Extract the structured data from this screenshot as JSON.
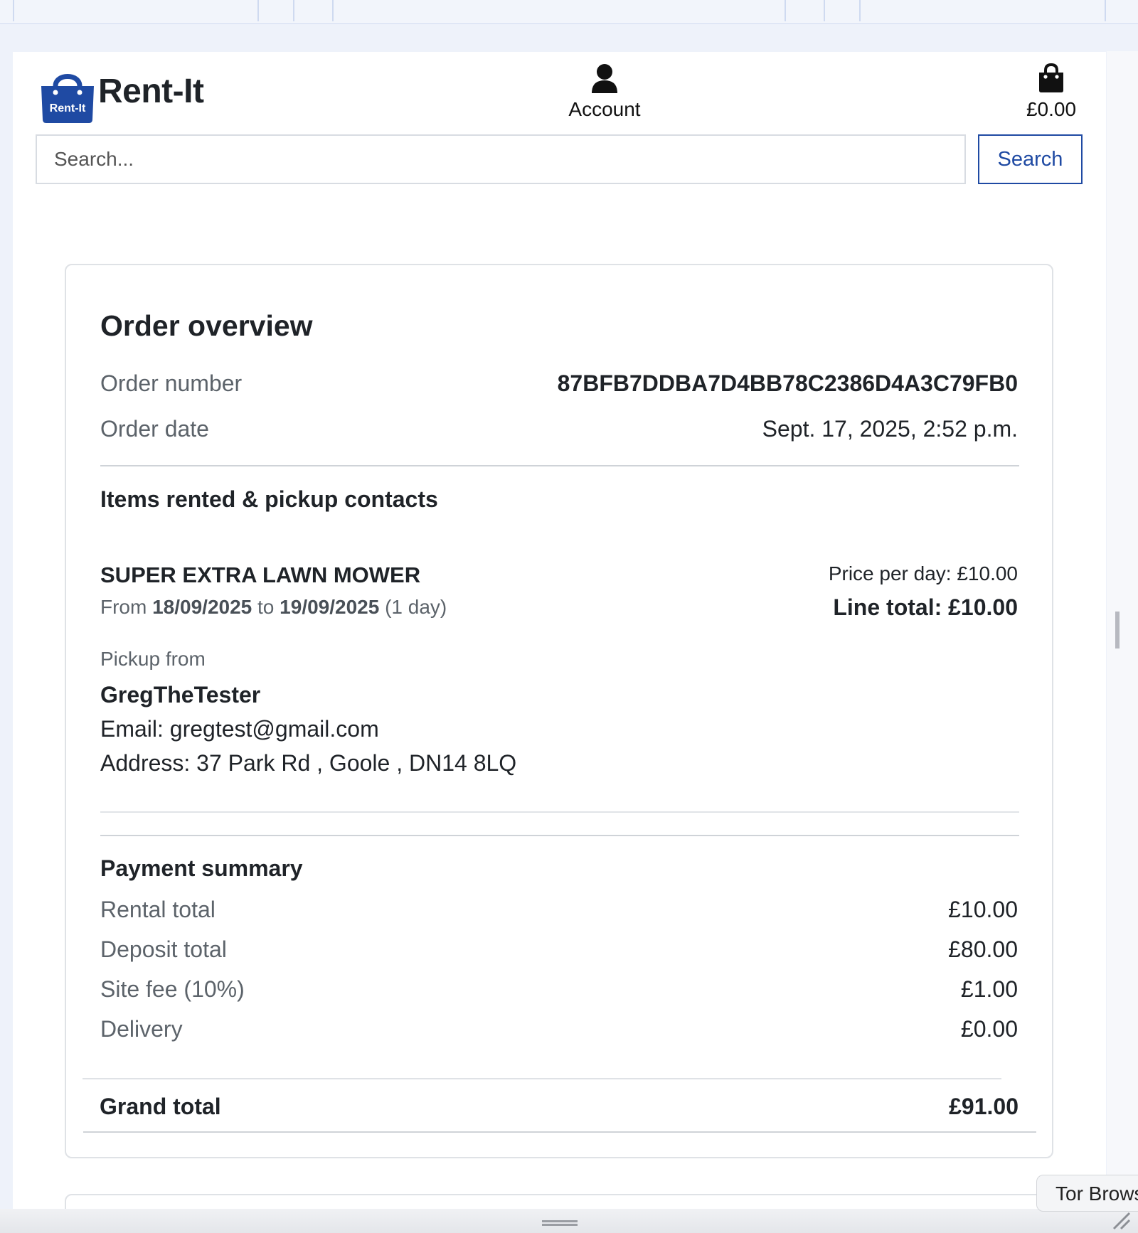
{
  "header": {
    "brand": "Rent-It",
    "logo_text": "Rent-It",
    "account_label": "Account",
    "basket_total": "£0.00"
  },
  "search": {
    "placeholder": "Search...",
    "button_label": "Search"
  },
  "order": {
    "title": "Order overview",
    "number_label": "Order number",
    "number_value": "87BFB7DDBA7D4BB78C2386D4A3C79FB0",
    "date_label": "Order date",
    "date_value": "Sept. 17, 2025, 2:52 p.m."
  },
  "items_section": {
    "title": "Items rented & pickup contacts",
    "items": [
      {
        "name": "SUPER EXTRA LAWN MOWER",
        "from_word": "From",
        "from_date": "18/09/2025",
        "to_word": "to",
        "to_date": "19/09/2025",
        "duration": "(1 day)",
        "price_per_day": "Price per day: £10.00",
        "line_total": "Line total: £10.00",
        "pickup_label": "Pickup from",
        "owner_name": "GregTheTester",
        "email": "Email: gregtest@gmail.com",
        "address": "Address: 37 Park Rd , Goole , DN14 8LQ"
      }
    ]
  },
  "payment": {
    "title": "Payment summary",
    "rows": [
      {
        "label": "Rental total",
        "value": "£10.00"
      },
      {
        "label": "Deposit total",
        "value": "£80.00"
      },
      {
        "label": "Site fee (10%)",
        "value": "£1.00"
      },
      {
        "label": "Delivery",
        "value": "£0.00"
      }
    ],
    "grand_label": "Grand total",
    "grand_value": "£91.00"
  },
  "browser": {
    "tooltip": "Tor Browser"
  },
  "colors": {
    "brand_blue": "#1f4aa3",
    "text": "#1f2328",
    "muted": "#5c636a"
  }
}
